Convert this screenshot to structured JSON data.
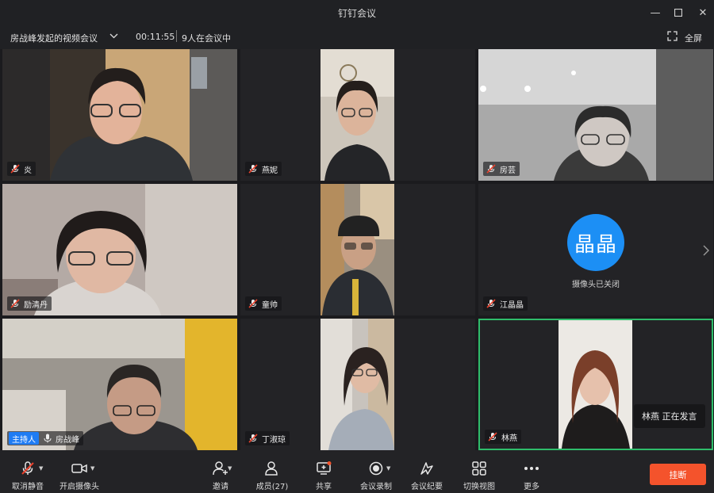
{
  "window": {
    "title": "钉钉会议"
  },
  "infobar": {
    "meeting_name": "房战峰发起的视频会议",
    "timer": "00:11:55",
    "participant_count": "9人在会议中",
    "fullscreen_label": "全屏"
  },
  "tiles": [
    {
      "name": "炎",
      "muted": true
    },
    {
      "name": "燕妮",
      "muted": true
    },
    {
      "name": "房芸",
      "muted": true
    },
    {
      "name": "励清丹",
      "muted": true
    },
    {
      "name": "童帅",
      "muted": true
    },
    {
      "name": "江晶晶",
      "muted": true,
      "avatar_text": "晶晶",
      "status": "摄像头已关闭"
    },
    {
      "name": "房战峰",
      "host_badge": "主持人",
      "muted": false
    },
    {
      "name": "丁淑琼",
      "muted": true
    },
    {
      "name": "林燕",
      "muted": true,
      "speaking_text": "林燕  正在发言"
    }
  ],
  "toolbar": {
    "unmute": "取消静音",
    "camera": "开启摄像头",
    "invite": "邀请",
    "members": "成员(27)",
    "share": "共享",
    "record": "会议录制",
    "minutes": "会议纪要",
    "switch_view": "切换视图",
    "more": "更多",
    "hangup": "挂断"
  },
  "colors": {
    "background": "#1b1b1e",
    "avatar_blue": "#1c8ff5",
    "speaking_border": "#2fbd6b",
    "host_badge": "#1f7cf4",
    "hangup": "#f4532c",
    "mute_red": "#e8412c"
  }
}
